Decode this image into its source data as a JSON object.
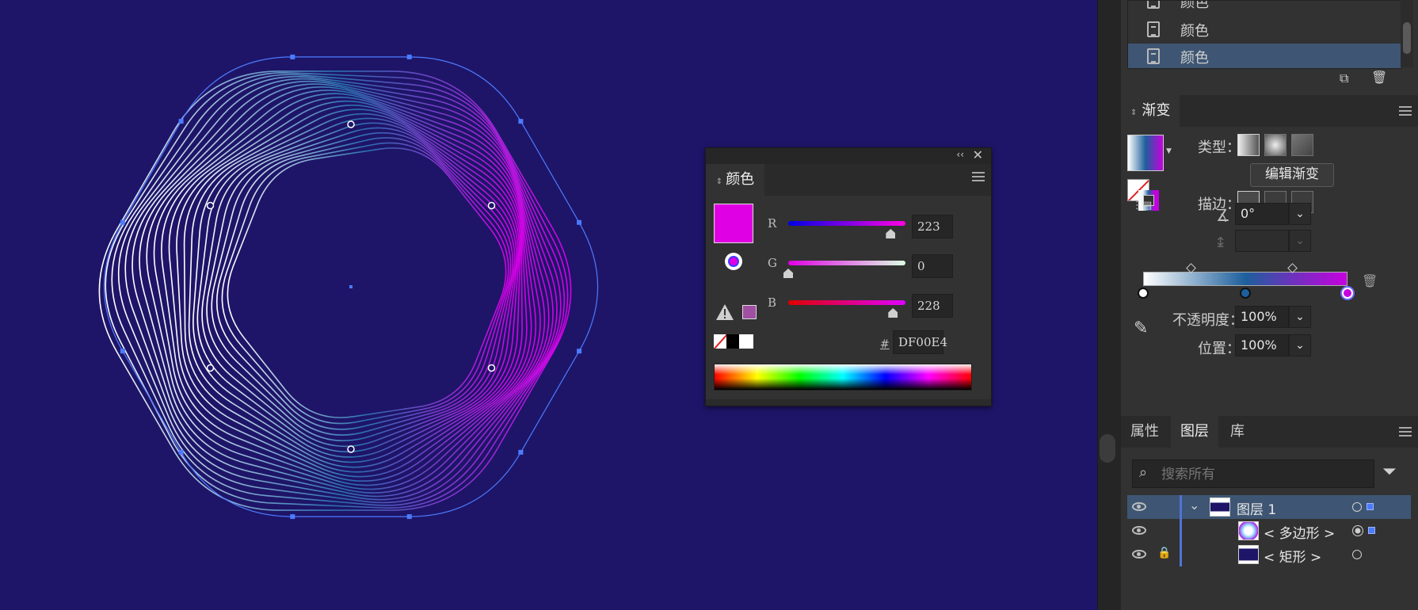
{
  "color_panel": {
    "tab": "颜色",
    "r_label": "R",
    "g_label": "G",
    "b_label": "B",
    "r_value": "223",
    "g_value": "0",
    "b_value": "228",
    "r_level": 0.874,
    "g_level": 0.0,
    "b_level": 0.894,
    "hash_label": "#",
    "hex_value": "DF00E4",
    "fill_color": "#df00e4",
    "gamut_swatch": "#a04fa2"
  },
  "swatches_list": {
    "items": [
      "颜色",
      "颜色",
      "颜色"
    ]
  },
  "gradient_panel": {
    "tab": "渐变",
    "type_label": "类型：",
    "edit_button": "编辑渐变",
    "stroke_label": "描边：",
    "angle_value": "0°",
    "opacity_label": "不透明度：",
    "opacity_value": "100%",
    "position_label": "位置：",
    "position_value": "100%",
    "stops": [
      {
        "color": "#ffffff",
        "location": 0.0
      },
      {
        "color": "#1d5f9c",
        "location": 0.5
      },
      {
        "color": "#c700e0",
        "location": 1.0
      }
    ]
  },
  "layers_panel": {
    "tabs": [
      "属性",
      "图层",
      "库"
    ],
    "search_placeholder": "搜索所有",
    "rows": [
      {
        "name": "图层 1"
      },
      {
        "name": "< 多边形 >"
      },
      {
        "name": "< 矩形 >"
      }
    ]
  },
  "colors": {
    "canvas_bg": "#1e1568",
    "accent_selection": "#4c7bff"
  }
}
